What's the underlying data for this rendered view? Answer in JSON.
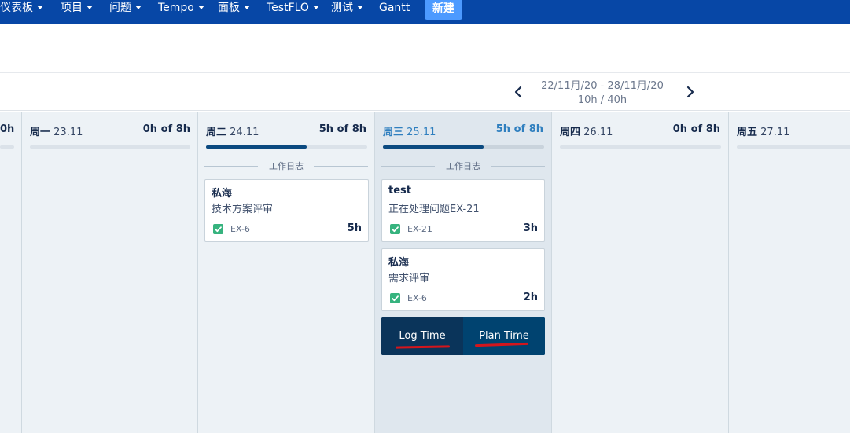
{
  "nav": {
    "items": [
      {
        "label": "仪表板",
        "caret": true
      },
      {
        "label": "项目",
        "caret": true
      },
      {
        "label": "问题",
        "caret": true
      },
      {
        "label": "Tempo",
        "caret": true
      },
      {
        "label": "面板",
        "caret": true
      },
      {
        "label": "TestFLO",
        "caret": true
      },
      {
        "label": "测试",
        "caret": true
      },
      {
        "label": "Gantt",
        "caret": false
      }
    ],
    "create_label": "新建"
  },
  "period": {
    "range": "22/11月/20 - 28/11月/20",
    "total": "10h / 40h",
    "prev_icon": "chevron-left-icon",
    "next_icon": "chevron-right-icon"
  },
  "columns": [
    {
      "weekday": "",
      "date": "",
      "hours": "0h",
      "progress": 0
    },
    {
      "weekday": "周一",
      "date": "23.11",
      "hours": "0h of 8h",
      "progress": 0
    },
    {
      "weekday": "周二",
      "date": "24.11",
      "hours": "5h of 8h",
      "progress": 0.625,
      "section": "工作日志"
    },
    {
      "weekday": "周三",
      "date": "25.11",
      "hours": "5h of 8h",
      "progress": 0.625,
      "section": "工作日志",
      "today": true
    },
    {
      "weekday": "周四",
      "date": "26.11",
      "hours": "0h of 8h",
      "progress": 0
    },
    {
      "weekday": "周五",
      "date": "27.11",
      "hours": "",
      "progress": 0
    }
  ],
  "worklogs": [
    {
      "author": "私海",
      "description": "技术方案评审",
      "issue_key": "EX-6",
      "hours": "5h"
    },
    {
      "author": "test",
      "description": "正在处理问题EX-21",
      "issue_key": "EX-21",
      "hours": "3h"
    },
    {
      "author": "私海",
      "description": "需求评审",
      "issue_key": "EX-6",
      "hours": "2h"
    }
  ],
  "actions": {
    "log_time": "Log Time",
    "plan_time": "Plan Time"
  },
  "colors": {
    "nav_bg": "#0747a6",
    "create_btn": "#4c9aff",
    "progress": "#0b4a80",
    "check": "#36b37e",
    "annotation_underline": "#d4151c"
  }
}
